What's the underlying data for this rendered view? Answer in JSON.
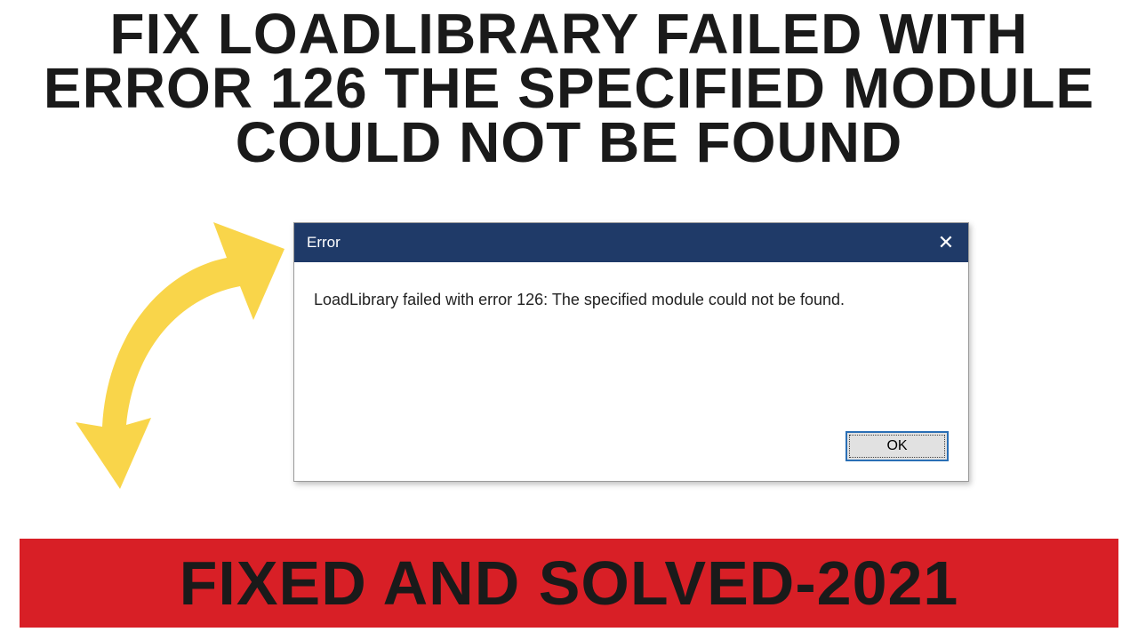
{
  "headline": "FIX LOADLIBRARY FAILED WITH ERROR 126 THE SPECIFIED MODULE COULD NOT BE FOUND",
  "dialog": {
    "title": "Error",
    "message": "LoadLibrary failed with error 126: The specified module could not be found.",
    "ok_label": "OK"
  },
  "banner": "FIXED AND SOLVED-2021",
  "colors": {
    "titlebar": "#1f3a68",
    "banner_bg": "#d81f26",
    "arrow": "#f9d54a"
  }
}
